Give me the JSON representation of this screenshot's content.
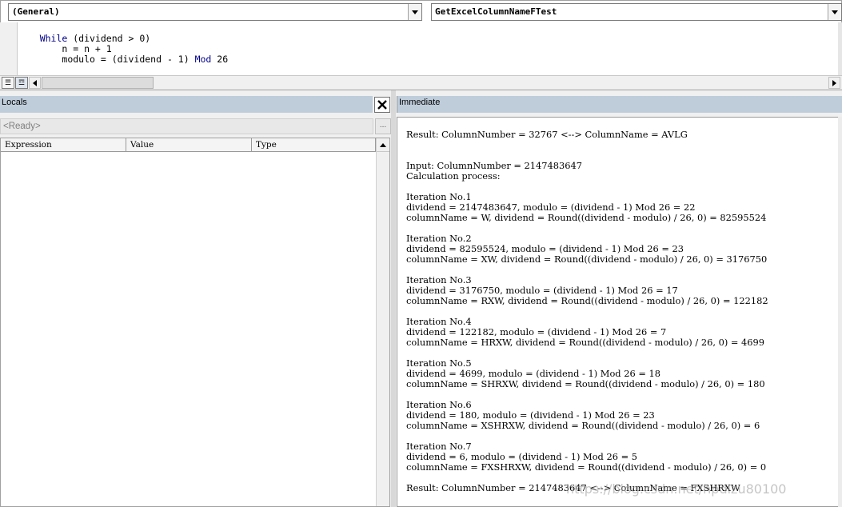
{
  "code_window": {
    "object_combo": "(General)",
    "procedure_combo": "GetExcelColumnNameFTest",
    "code_lines": [
      {
        "indent": "    ",
        "keyword": "While",
        "rest": " (dividend > 0)"
      },
      {
        "indent": "        ",
        "keyword": "",
        "rest": "n = n + 1"
      },
      {
        "indent": "        ",
        "keyword": "",
        "rest": "modulo = (dividend - 1) ",
        "keyword2": "Mod",
        "rest2": " 26"
      }
    ]
  },
  "locals": {
    "title": "Locals",
    "status": "<Ready>",
    "dots_label": "...",
    "columns": [
      "Expression",
      "Value",
      "Type"
    ]
  },
  "immediate": {
    "title": "Immediate",
    "lines": [
      "Result: ColumnNumber = 32767 <--> ColumnName = AVLG",
      "",
      "",
      "Input: ColumnNumber = 2147483647",
      "Calculation process:",
      "",
      "Iteration No.1",
      "dividend = 2147483647, modulo = (dividend - 1) Mod 26 = 22",
      "columnName = W, dividend = Round((dividend - modulo) / 26, 0) = 82595524",
      "",
      "Iteration No.2",
      "dividend = 82595524, modulo = (dividend - 1) Mod 26 = 23",
      "columnName = XW, dividend = Round((dividend - modulo) / 26, 0) = 3176750",
      "",
      "Iteration No.3",
      "dividend = 3176750, modulo = (dividend - 1) Mod 26 = 17",
      "columnName = RXW, dividend = Round((dividend - modulo) / 26, 0) = 122182",
      "",
      "Iteration No.4",
      "dividend = 122182, modulo = (dividend - 1) Mod 26 = 7",
      "columnName = HRXW, dividend = Round((dividend - modulo) / 26, 0) = 4699",
      "",
      "Iteration No.5",
      "dividend = 4699, modulo = (dividend - 1) Mod 26 = 18",
      "columnName = SHRXW, dividend = Round((dividend - modulo) / 26, 0) = 180",
      "",
      "Iteration No.6",
      "dividend = 180, modulo = (dividend - 1) Mod 26 = 23",
      "columnName = XSHRXW, dividend = Round((dividend - modulo) / 26, 0) = 6",
      "",
      "Iteration No.7",
      "dividend = 6, modulo = (dividend - 1) Mod 26 = 5",
      "columnName = FXSHRXW, dividend = Round((dividend - modulo) / 26, 0) = 0",
      "",
      "Result: ColumnNumber = 2147483647 <--> ColumnName = FXSHRXW"
    ]
  },
  "watermark": "https://blog.csdn.net/hpdlzu80100",
  "colors": {
    "keyword": "#00008b",
    "pane_title_bg": "#bfcddb"
  }
}
